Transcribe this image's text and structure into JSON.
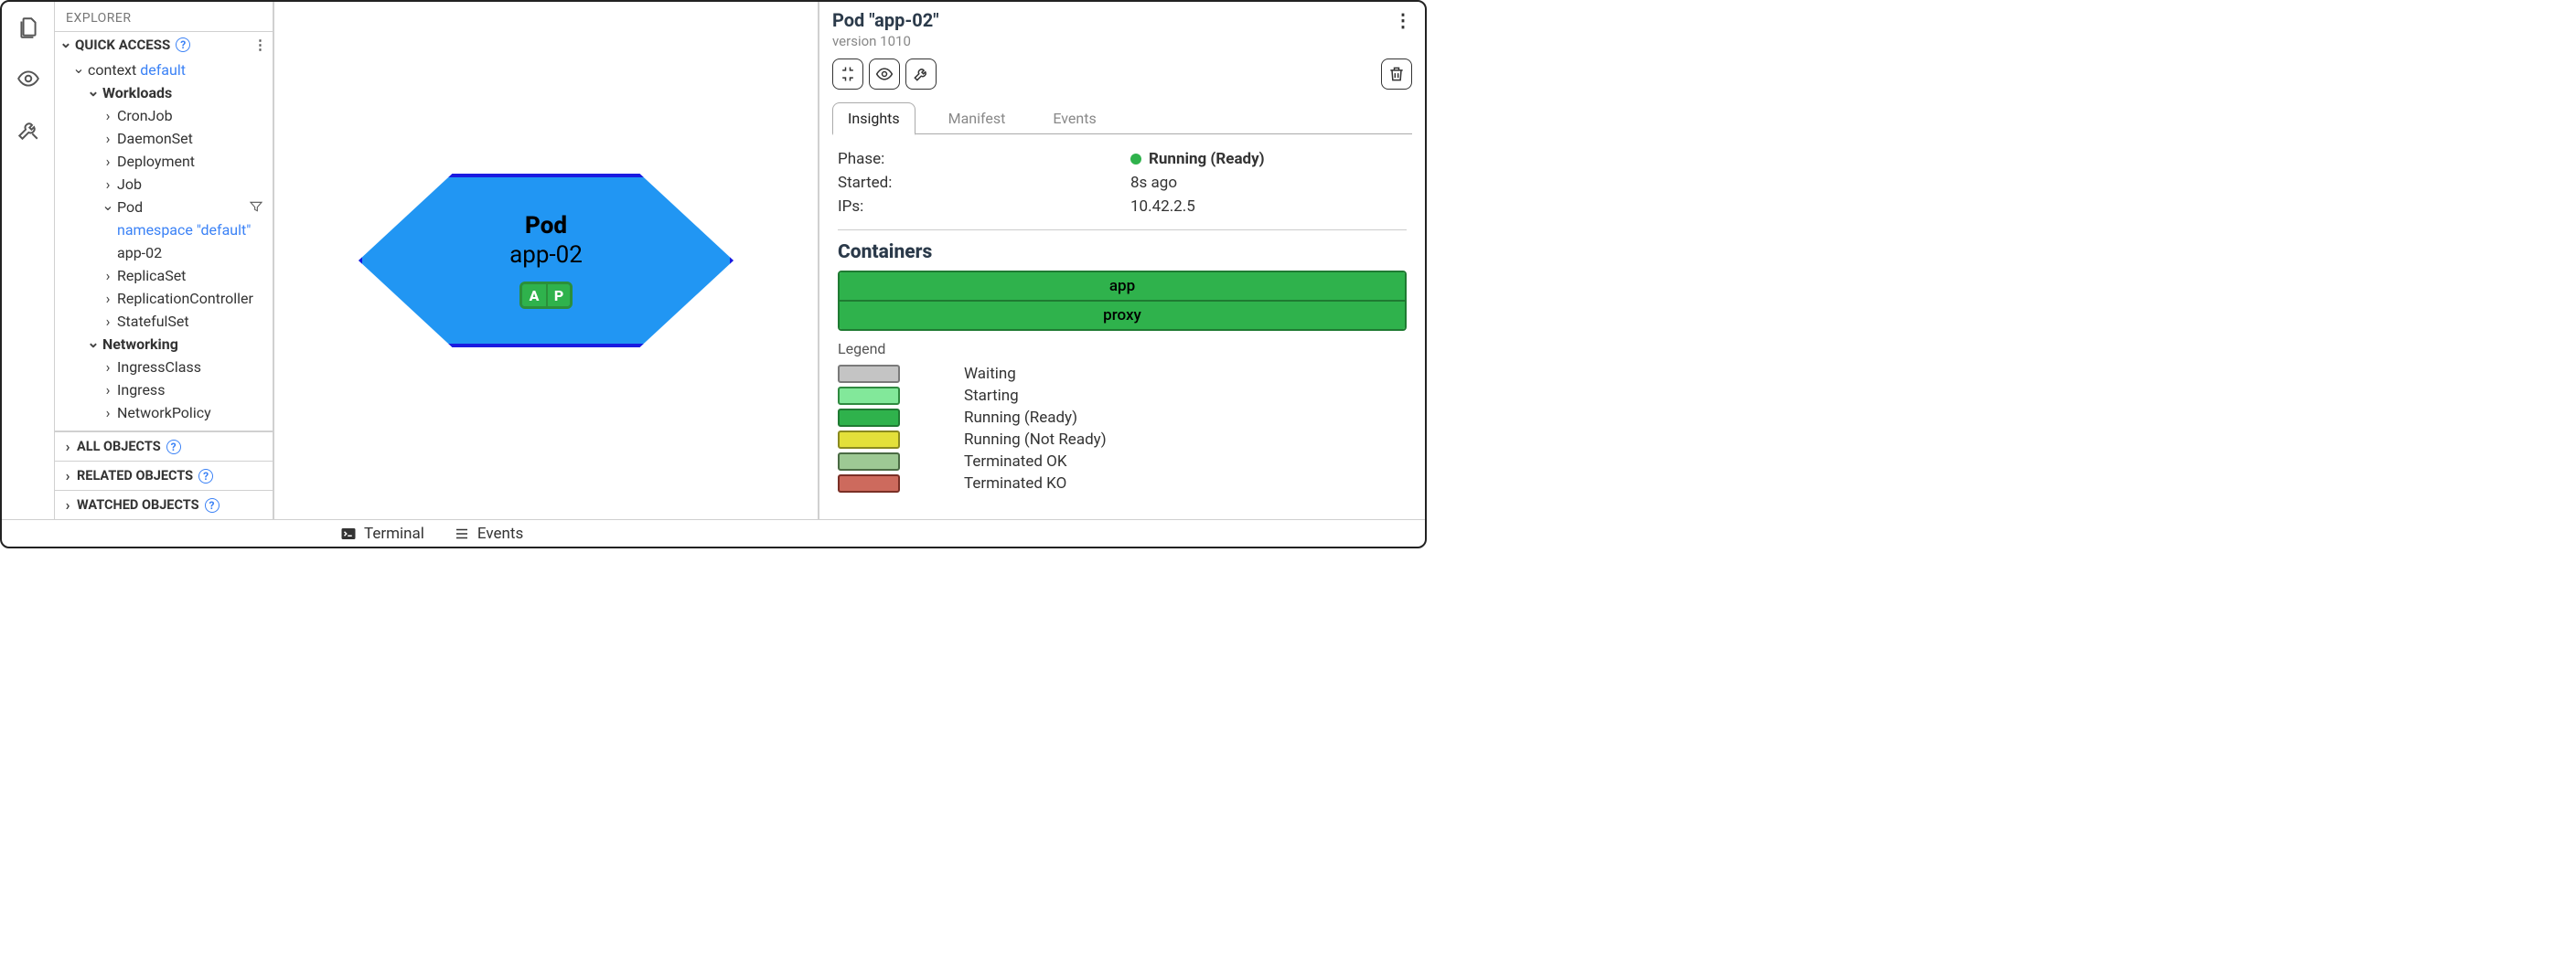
{
  "explorer": {
    "title": "EXPLORER",
    "sections": {
      "quickAccess": {
        "label": "QUICK ACCESS"
      },
      "allObjects": {
        "label": "ALL OBJECTS"
      },
      "relatedObjects": {
        "label": "RELATED OBJECTS"
      },
      "watchedObjects": {
        "label": "WATCHED OBJECTS"
      }
    },
    "context": {
      "prefix": "context ",
      "name": "default"
    },
    "groups": {
      "workloads": "Workloads",
      "networking": "Networking"
    },
    "workloadItems": {
      "cronjob": "CronJob",
      "daemonset": "DaemonSet",
      "deployment": "Deployment",
      "job": "Job",
      "pod": "Pod",
      "namespaceDefault": "namespace \"default\"",
      "appPod": "app-02",
      "replicaset": "ReplicaSet",
      "replicationcontroller": "ReplicationController",
      "statefulset": "StatefulSet"
    },
    "networkingItems": {
      "ingressclass": "IngressClass",
      "ingress": "Ingress",
      "networkpolicy": "NetworkPolicy"
    }
  },
  "canvas": {
    "pod": {
      "kind": "Pod",
      "name": "app-02",
      "badges": [
        "A",
        "P"
      ]
    }
  },
  "details": {
    "title": "Pod \"app-02\"",
    "version": "version 1010",
    "tabs": {
      "insights": "Insights",
      "manifest": "Manifest",
      "events": "Events"
    },
    "insights": {
      "phase": {
        "key": "Phase:",
        "value": "Running (Ready)"
      },
      "started": {
        "key": "Started:",
        "value": "8s ago"
      },
      "ips": {
        "key": "IPs:",
        "value": "10.42.2.5"
      }
    },
    "containersTitle": "Containers",
    "containers": [
      "app",
      "proxy"
    ],
    "legendTitle": "Legend",
    "legend": [
      {
        "label": "Waiting",
        "color": "#c4c4c4",
        "border": "#7a7a7a"
      },
      {
        "label": "Starting",
        "color": "#82e89a",
        "border": "#2f8a40"
      },
      {
        "label": "Running (Ready)",
        "color": "#2fb24c",
        "border": "#1f7a32"
      },
      {
        "label": "Running (Not Ready)",
        "color": "#e3e03a",
        "border": "#8a8a1f"
      },
      {
        "label": "Terminated OK",
        "color": "#9dc994",
        "border": "#4a6b44"
      },
      {
        "label": "Terminated KO",
        "color": "#cd6a5d",
        "border": "#7a2f26"
      }
    ]
  },
  "statusBar": {
    "terminal": "Terminal",
    "events": "Events"
  }
}
